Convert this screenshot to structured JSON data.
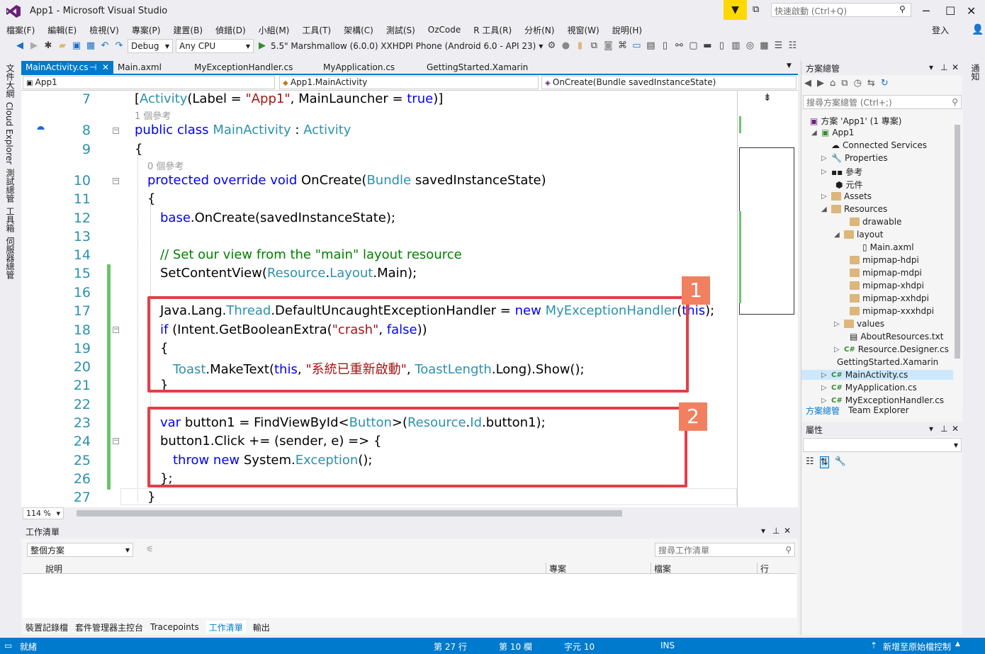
{
  "window": {
    "title": "App1 - Microsoft Visual Studio",
    "quick_launch_placeholder": "快速啟動 (Ctrl+Q)",
    "sign_in": "登入"
  },
  "menu": [
    "檔案(F)",
    "編輯(E)",
    "檢視(V)",
    "專案(P)",
    "建置(B)",
    "偵錯(D)",
    "小組(M)",
    "工具(T)",
    "架構(C)",
    "測試(S)",
    "OzCode",
    "R 工具(R)",
    "分析(N)",
    "視窗(W)",
    "說明(H)"
  ],
  "toolbar": {
    "config": "Debug",
    "platform": "Any CPU",
    "run_target": "5.5\" Marshmallow (6.0.0) XXHDPI Phone (Android 6.0 - API 23)"
  },
  "left_tabs": [
    "文件大綱",
    "Cloud Explorer",
    "測試總管",
    "工具箱",
    "伺服器總管"
  ],
  "right_edge_tab": "通知",
  "doc_tabs": [
    "MainActivity.cs",
    "Main.axml",
    "MyExceptionHandler.cs",
    "MyApplication.cs",
    "GettingStarted.Xamarin"
  ],
  "nav": {
    "project": "App1",
    "class": "App1.MainActivity",
    "member": "OnCreate(Bundle savedInstanceState)"
  },
  "editor": {
    "zoom": "114 %",
    "ref1": "1 個參考",
    "ref0": "0 個參考",
    "line_numbers": [
      "7",
      "8",
      "9",
      "10",
      "11",
      "12",
      "13",
      "14",
      "15",
      "16",
      "17",
      "18",
      "19",
      "20",
      "21",
      "22",
      "23",
      "24",
      "25",
      "26",
      "27"
    ],
    "badges": [
      "1",
      "2"
    ]
  },
  "solution_explorer": {
    "title": "方案總管",
    "search_placeholder": "搜尋方案總管 (Ctrl+;)",
    "items": [
      "方案 'App1' (1 專案)",
      "App1",
      "Connected Services",
      "Properties",
      "參考",
      "元件",
      "Assets",
      "Resources",
      "drawable",
      "layout",
      "Main.axml",
      "mipmap-hdpi",
      "mipmap-mdpi",
      "mipmap-xhdpi",
      "mipmap-xxhdpi",
      "mipmap-xxxhdpi",
      "values",
      "AboutResources.txt",
      "Resource.Designer.cs",
      "GettingStarted.Xamarin",
      "MainActivity.cs",
      "MyApplication.cs",
      "MyExceptionHandler.cs"
    ],
    "bottom_tabs": [
      "方案總管",
      "Team Explorer"
    ]
  },
  "properties": {
    "title": "屬性"
  },
  "task_list": {
    "title": "工作清單",
    "scope": "整個方案",
    "search_placeholder": "搜尋工作清單",
    "columns": [
      "說明",
      "專案",
      "檔案",
      "行"
    ],
    "bottom_tabs": [
      "裝置記錄檔",
      "套件管理器主控台",
      "Tracepoints",
      "工作清單",
      "輸出"
    ]
  },
  "status": {
    "ready": "就緒",
    "line": "第 27 行",
    "col": "第 10 欄",
    "ch": "字元 10",
    "ins": "INS",
    "source_control": "新增至原始檔控制"
  }
}
